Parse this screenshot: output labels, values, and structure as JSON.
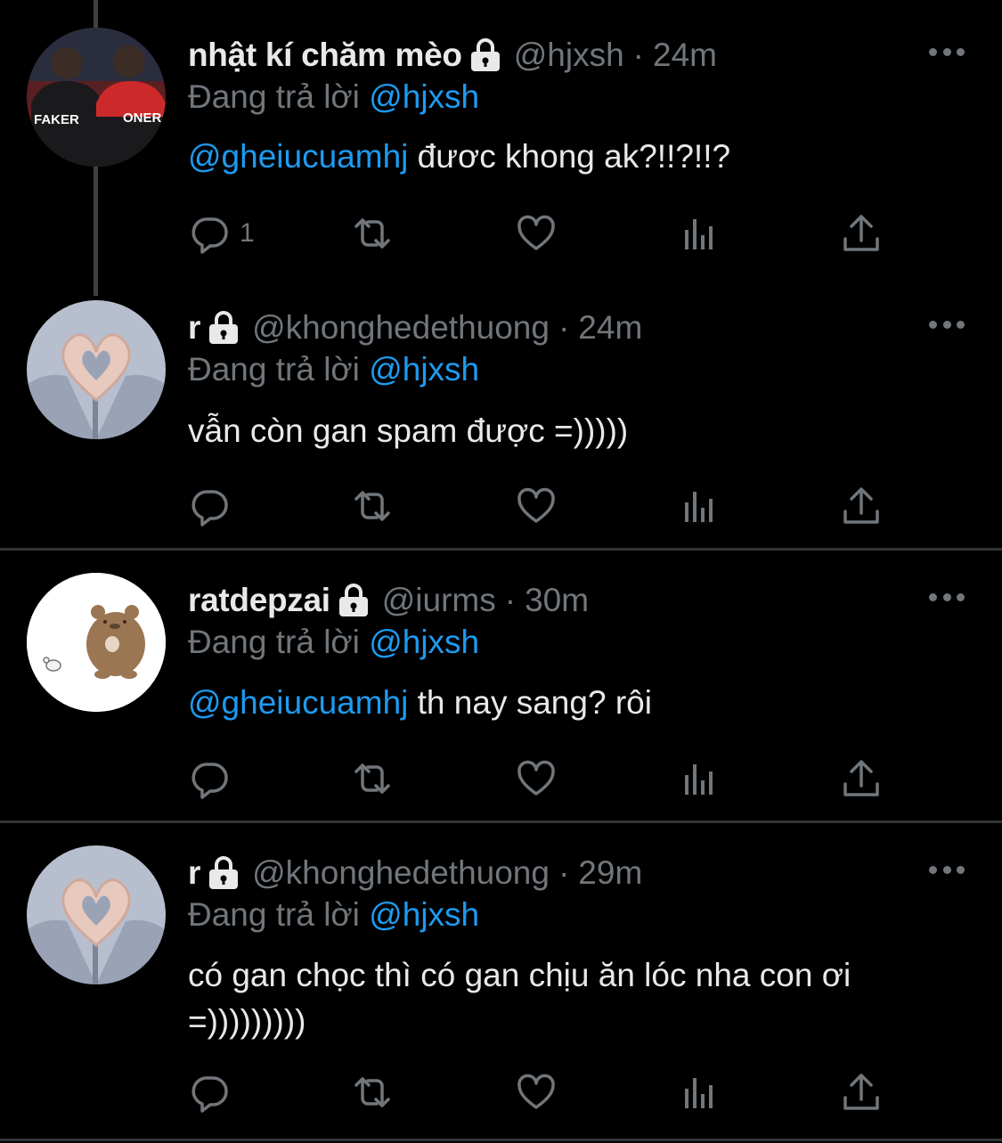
{
  "colors": {
    "background": "#000000",
    "text": "#e7e9ea",
    "muted": "#71767b",
    "link": "#1d9bf0",
    "divider": "#2f3336"
  },
  "tweets": [
    {
      "name": "nhật kí chăm mèo",
      "handle": "@hjxsh",
      "separator": "·",
      "time": "24m",
      "replying_prefix": "Đang trả lời",
      "replying_to": "@hjxsh",
      "mention": "@gheiucuamhj",
      "text": " đươc khong ak?!!?!!?",
      "reply_count": "1",
      "avatar_labels": [
        "FAKER",
        "ONER"
      ]
    },
    {
      "name": "r",
      "handle": "@khonghedethuong",
      "separator": "·",
      "time": "24m",
      "replying_prefix": "Đang trả lời",
      "replying_to": "@hjxsh",
      "mention": "",
      "text": "vẫn còn gan spam được =)))))",
      "reply_count": ""
    },
    {
      "name": "ratdepzai",
      "handle": "@iurms",
      "separator": "·",
      "time": "30m",
      "replying_prefix": "Đang trả lời",
      "replying_to": "@hjxsh",
      "mention": "@gheiucuamhj",
      "text": " th nay sang? rôi",
      "reply_count": ""
    },
    {
      "name": "r",
      "handle": "@khonghedethuong",
      "separator": "·",
      "time": "29m",
      "replying_prefix": "Đang trả lời",
      "replying_to": "@hjxsh",
      "mention": "",
      "text": "có gan chọc thì có gan chịu ăn lóc nha con ơi =)))))))))",
      "reply_count": ""
    }
  ],
  "icons": [
    "reply-icon",
    "retweet-icon",
    "like-icon",
    "views-icon",
    "share-icon",
    "lock-icon",
    "more-icon"
  ]
}
